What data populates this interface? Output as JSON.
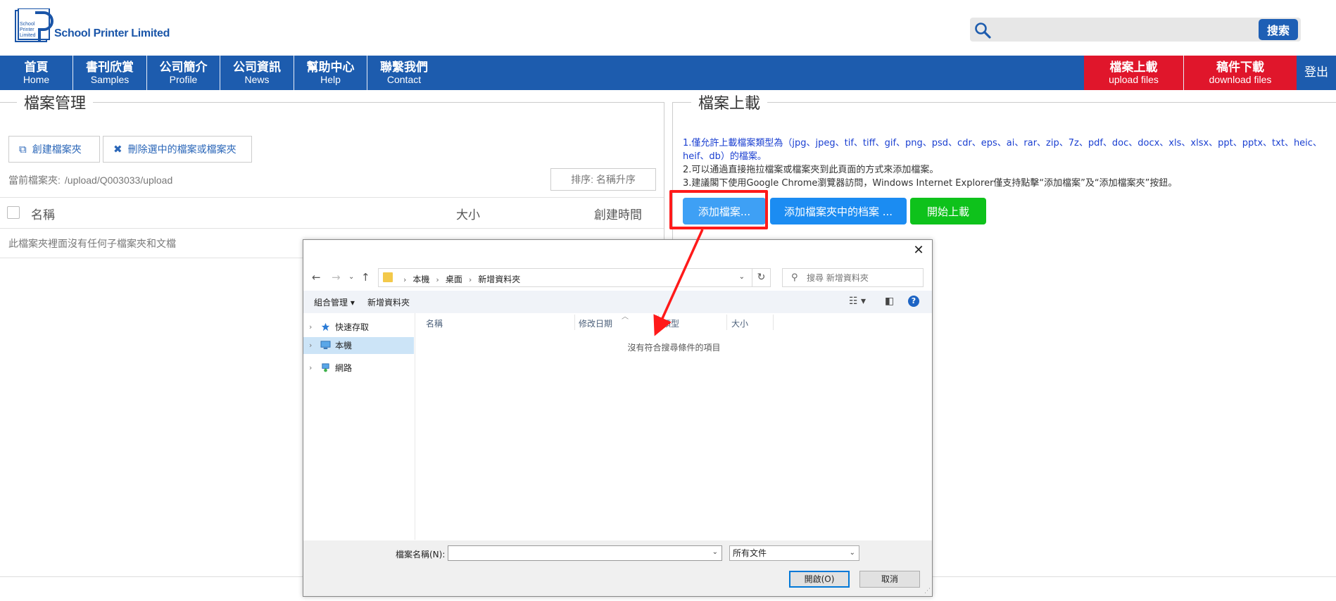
{
  "header": {
    "brand_name": "School Printer Limited",
    "logo_text": [
      "School",
      "Printer",
      "Limited"
    ],
    "logo_letter": "P",
    "search_placeholder": "",
    "search_button": "搜索"
  },
  "nav": {
    "items": [
      {
        "zh": "首頁",
        "en": "Home"
      },
      {
        "zh": "書刊欣賞",
        "en": "Samples"
      },
      {
        "zh": "公司簡介",
        "en": "Profile"
      },
      {
        "zh": "公司資訊",
        "en": "News"
      },
      {
        "zh": "幫助中心",
        "en": "Help"
      },
      {
        "zh": "聯繫我們",
        "en": "Contact"
      }
    ],
    "upload": {
      "zh": "檔案上載",
      "en": "upload files"
    },
    "download": {
      "zh": "稿件下載",
      "en": "download files"
    },
    "logout": "登出"
  },
  "file_manager": {
    "title": "檔案管理",
    "create_folder": "創建檔案夾",
    "delete_selected": "刪除選中的檔案或檔案夾",
    "current_folder_label": "當前檔案夾:",
    "current_folder_path": "/upload/Q003033/upload",
    "sort_button": "排序: 名稱升序",
    "columns": {
      "name": "名稱",
      "size": "大小",
      "created": "創建時間"
    },
    "empty_message": "此檔案夾裡面沒有任何子檔案夾和文檔"
  },
  "upload_panel": {
    "title": "檔案上載",
    "note1": "1.僅允許上載檔案類型為（jpg、jpeg、tif、tiff、gif、png、psd、cdr、eps、ai、rar、zip、7z、pdf、doc、docx、xls、xlsx、ppt、pptx、txt、heic、heif、db）的檔案。",
    "note2": "2.可以通過直接拖拉檔案或檔案夾到此頁面的方式來添加檔案。",
    "note3": "3.建議閣下使用Google Chrome瀏覽器訪問，Windows Internet Explorer僅支持點擊“添加檔案”及“添加檔案夾”按鈕。",
    "add_files": "添加檔案...",
    "add_folder_files": "添加檔案夾中的档案 ...",
    "start_upload": "開始上載"
  },
  "dialog": {
    "breadcrumb": [
      "本機",
      "桌面",
      "新增資料夾"
    ],
    "search_placeholder": "搜尋 新增資料夾",
    "organize": "組合管理 ▾",
    "new_folder": "新增資料夾",
    "tree": [
      "快速存取",
      "本機",
      "網路"
    ],
    "columns": [
      "名稱",
      "修改日期",
      "類型",
      "大小"
    ],
    "empty_message": "沒有符合搜尋條件的項目",
    "filename_label": "檔案名稱(N):",
    "filename_value": "",
    "filetype": "所有文件",
    "open_button": "開啟(O)",
    "cancel_button": "取消"
  },
  "colors": {
    "nav_blue": "#1d5cae",
    "nav_red": "#e0162b",
    "add_files_btn": "#3ea0f5",
    "add_folder_btn": "#1b8cf2",
    "start_upload_btn": "#0ec21b",
    "highlight_red": "#ff1a1a"
  }
}
